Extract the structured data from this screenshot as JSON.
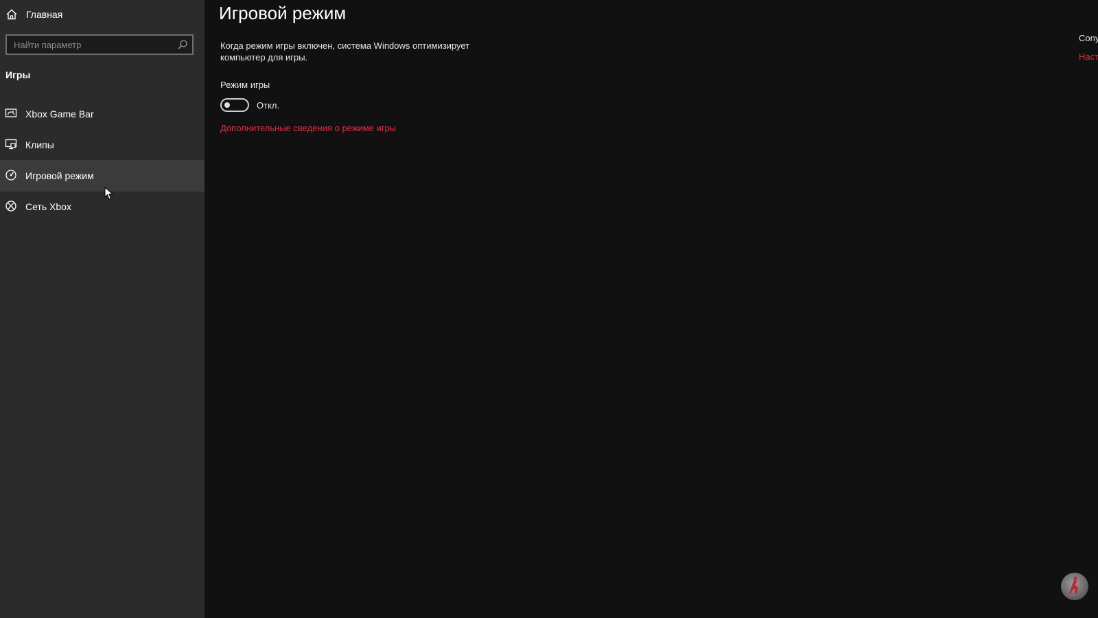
{
  "sidebar": {
    "home_label": "Главная",
    "search_placeholder": "Найти параметр",
    "section_title": "Игры",
    "items": [
      {
        "label": "Xbox Game Bar",
        "icon": "xbox-game-bar-icon"
      },
      {
        "label": "Клипы",
        "icon": "captures-icon"
      },
      {
        "label": "Игровой режим",
        "icon": "game-mode-icon",
        "active": true
      },
      {
        "label": "Сеть Xbox",
        "icon": "xbox-icon"
      }
    ]
  },
  "main": {
    "title": "Игровой режим",
    "description": "Когда режим игры включен, система Windows оптимизирует компьютер для игры.",
    "setting_label": "Режим игры",
    "toggle_state": "Откл.",
    "more_info_link": "Дополнительные сведения о режиме игры",
    "right_text": "Cony",
    "right_link": "Наст"
  },
  "colors": {
    "sidebar_bg": "#2b2b2b",
    "main_bg": "#111111",
    "active_item_bg": "#3b3b3b",
    "accent_link": "#d9333f"
  },
  "toggle_on": false
}
